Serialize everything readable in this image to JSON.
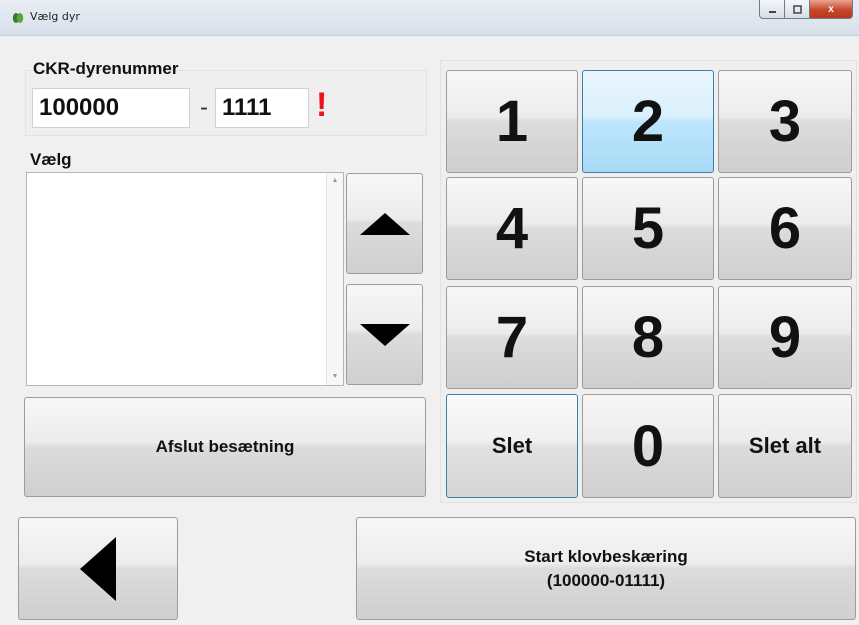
{
  "window": {
    "title": "Vælg dyr",
    "close_glyph": "x"
  },
  "ckr": {
    "label": "CKR-dyrenummer",
    "herd_number": "100000",
    "separator": "-",
    "animal_number": "1111",
    "warning_mark": "!"
  },
  "select": {
    "label": "Vælg",
    "items": []
  },
  "buttons": {
    "finish_herd": "Afslut besætning",
    "delete": "Slet",
    "delete_all": "Slet alt",
    "start_line1": "Start klovbeskæring",
    "start_line2": "(100000-01111)"
  },
  "keypad": {
    "k1": "1",
    "k2": "2",
    "k3": "3",
    "k4": "4",
    "k5": "5",
    "k6": "6",
    "k7": "7",
    "k8": "8",
    "k9": "9",
    "k0": "0",
    "active_key": "2"
  },
  "colors": {
    "warning": "#e8141a",
    "active_key": "#bee6fd",
    "focus_border": "#3c7fb1"
  },
  "icons": {
    "up": "triangle-up-icon",
    "down": "triangle-down-icon",
    "back": "triangle-left-icon",
    "app": "leaf-icon"
  }
}
